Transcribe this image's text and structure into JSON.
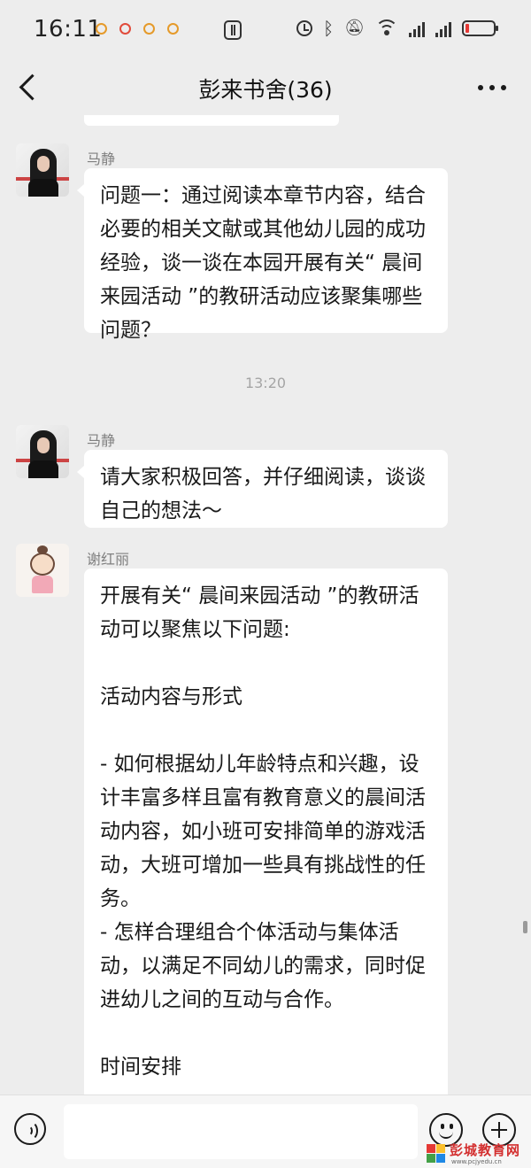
{
  "status_bar": {
    "time": "16:11"
  },
  "header": {
    "title": "彭来书舍(36)"
  },
  "messages": [
    {
      "sender": "马静",
      "text": "问题一：通过阅读本章节内容，结合必要的相关文献或其他幼儿园的成功经验，谈一谈在本园开展有关“ 晨间来园活动 ”的教研活动应该聚集哪些问题？"
    },
    {
      "sender": "马静",
      "text": "请大家积极回答，并仔细阅读，谈谈自己的想法～"
    },
    {
      "sender": "谢红丽",
      "text": "开展有关“ 晨间来园活动 ”的教研活动可以聚焦以下问题:\n\n活动内容与形式\n\n- 如何根据幼儿年龄特点和兴趣，设计丰富多样且富有教育意义的晨间活动内容，如小班可安排简单的游戏活动，大班可增加一些具有挑战性的任务。\n- 怎样合理组合个体活动与集体活动，以满足不同幼儿的需求，同时促进幼儿之间的互动与合作。\n\n时间安排\n\n- 如何确定适宜的来园时间范围，既能保证幼儿有充足的休息，又能"
    }
  ],
  "timestamp": "13:20",
  "watermark": {
    "text": "彭城教育网",
    "url": "www.pcjyedu.cn"
  },
  "colors": {
    "background": "#ededed",
    "bubble": "#ffffff",
    "battery_low": "#e53935",
    "watermark": "#d32f2f"
  },
  "icons": [
    "back-icon",
    "more-icon",
    "voice-icon",
    "emoji-icon",
    "plus-icon",
    "nfc-icon",
    "alarm-icon",
    "bluetooth-icon",
    "mute-icon",
    "wifi-icon",
    "signal-icon",
    "battery-icon"
  ]
}
